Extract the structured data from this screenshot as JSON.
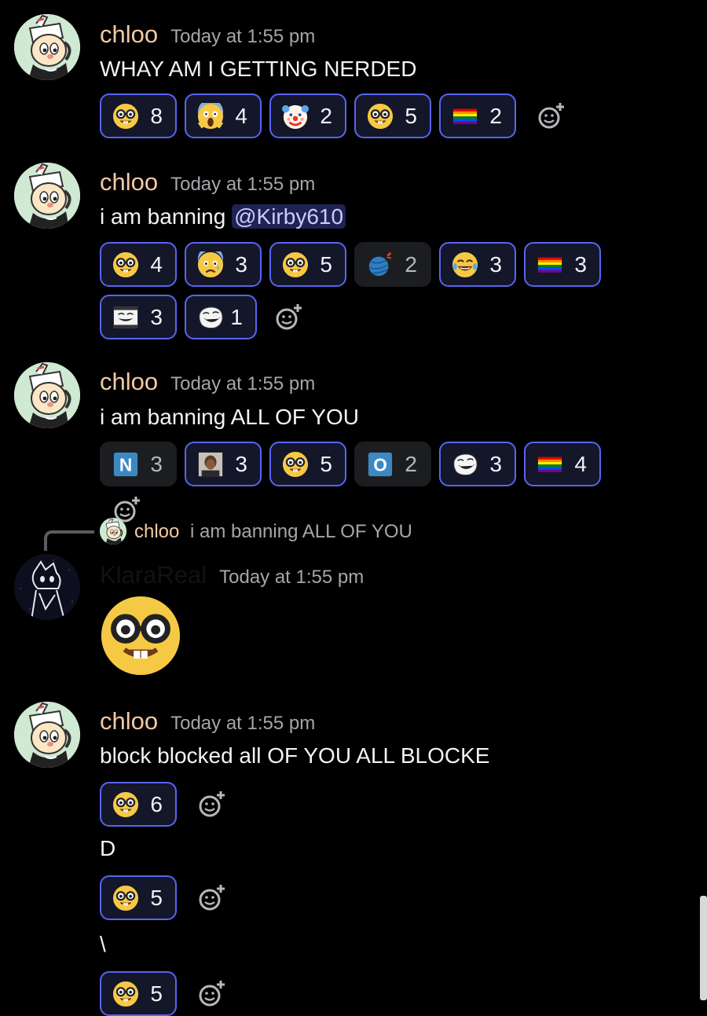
{
  "messages": [
    {
      "username": "chloo",
      "timestamp": "Today at 1:55 pm",
      "text": "WHAY AM I GETTING NERDED",
      "reactions": [
        {
          "emoji": "nerd-face",
          "count": "8",
          "me": true
        },
        {
          "emoji": "screaming-face",
          "count": "4",
          "me": true
        },
        {
          "emoji": "clown-face",
          "count": "2",
          "me": true
        },
        {
          "emoji": "nerd-face-alt",
          "count": "5",
          "me": true
        },
        {
          "emoji": "rainbow-flag",
          "count": "2",
          "me": true
        }
      ]
    },
    {
      "username": "chloo",
      "timestamp": "Today at 1:55 pm",
      "text_prefix": "i am banning ",
      "mention": "@Kirby610",
      "reactions": [
        {
          "emoji": "nerd-face-alt",
          "count": "4",
          "me": true
        },
        {
          "emoji": "anxious-face",
          "count": "3",
          "me": true
        },
        {
          "emoji": "nerd-face",
          "count": "5",
          "me": true
        },
        {
          "emoji": "yarn-ball",
          "count": "2",
          "me": false
        },
        {
          "emoji": "crying-laughing-face",
          "count": "3",
          "me": true
        },
        {
          "emoji": "rainbow-flag",
          "count": "3",
          "me": true
        },
        {
          "emoji": "trollface-meme",
          "count": "3",
          "me": true
        },
        {
          "emoji": "trollface",
          "count": "1",
          "me": true
        }
      ]
    },
    {
      "username": "chloo",
      "timestamp": "Today at 1:55 pm",
      "text": "i am banning ALL OF YOU",
      "reactions": [
        {
          "emoji": "letter-n",
          "count": "3",
          "me": false
        },
        {
          "emoji": "photo-face",
          "count": "3",
          "me": true
        },
        {
          "emoji": "nerd-face",
          "count": "5",
          "me": true
        },
        {
          "emoji": "letter-o",
          "count": "2",
          "me": false
        },
        {
          "emoji": "trollface",
          "count": "3",
          "me": true
        },
        {
          "emoji": "rainbow-flag",
          "count": "4",
          "me": true
        }
      ]
    },
    {
      "username": "KlaraReal",
      "timestamp": "Today at 1:55 pm",
      "reply": {
        "username": "chloo",
        "text": "i am banning ALL OF YOU"
      },
      "big_emoji": "nerd-face"
    },
    {
      "username": "chloo",
      "timestamp": "Today at 1:55 pm",
      "text": "block blocked all OF YOU ALL BLOCKE",
      "reactions": [
        {
          "emoji": "nerd-face",
          "count": "6",
          "me": true
        }
      ],
      "followups": [
        {
          "text": "D",
          "reactions": [
            {
              "emoji": "nerd-face",
              "count": "5",
              "me": true
            }
          ]
        },
        {
          "text": "\\",
          "reactions": [
            {
              "emoji": "nerd-face",
              "count": "5",
              "me": true
            }
          ]
        }
      ]
    }
  ],
  "add_reaction_icon": "add-reaction-icon",
  "colors": {
    "background": "#000000",
    "username": "#f3c9a3",
    "timestamp": "#a4a6ab",
    "reaction_active_border": "#5865f2",
    "mention_bg": "#3a3f7a"
  }
}
